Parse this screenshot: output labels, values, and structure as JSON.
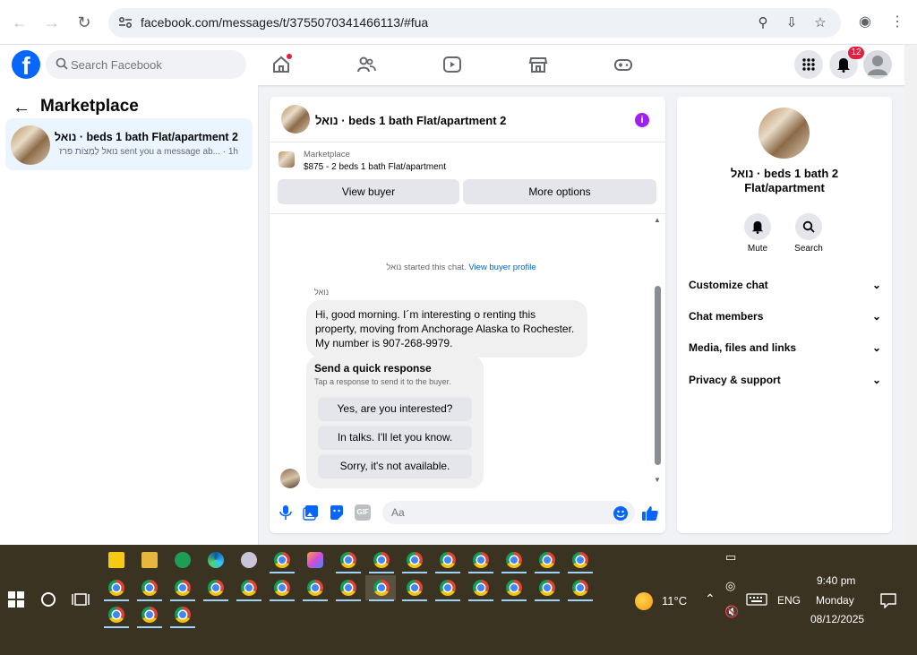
{
  "browser": {
    "url": "facebook.com/messages/t/3755070341466113/#fua"
  },
  "fb": {
    "search_placeholder": "Search Facebook",
    "notification_count": "12"
  },
  "left": {
    "title": "Marketplace",
    "conversation": {
      "title": "נואל · beds 1 bath Flat/apartment 2",
      "snippet": "נואל לַמְצוֹת פרז sent you a message ab...",
      "time": "· 1h"
    }
  },
  "chat": {
    "header_title": "נואל · beds 1 bath Flat/apartment 2",
    "listing_category": "Marketplace",
    "listing_price": "$875 - 2 beds 1 bath Flat/apartment",
    "view_buyer": "View buyer",
    "more_options": "More options",
    "system_text": "נואל started this chat.",
    "system_link": "View buyer profile",
    "sender_name": "נואל",
    "message": "Hi, good morning. I´m interesting o renting this property, moving from Anchorage Alaska to Rochester. My number is 907-268-9979.",
    "quick_title": "Send a quick response",
    "quick_sub": "Tap a response to send it to the buyer.",
    "quick_replies": [
      "Yes, are you interested?",
      "In talks. I'll let you know.",
      "Sorry, it's not available."
    ],
    "composer_placeholder": "Aa",
    "gif_label": "GIF"
  },
  "details": {
    "title_line1": "נואל · beds 1 bath 2",
    "title_line2": "Flat/apartment",
    "mute": "Mute",
    "search": "Search",
    "rows": [
      "Customize chat",
      "Chat members",
      "Media, files and links",
      "Privacy & support"
    ]
  },
  "taskbar": {
    "temperature": "11°C",
    "language": "ENG",
    "time": "9:40 pm",
    "day": "Monday",
    "date": "08/12/2025"
  },
  "colors": {
    "fb_blue": "#0866ff",
    "taskbar_bg": "#3b3322",
    "badge_red": "#e41e3f"
  }
}
